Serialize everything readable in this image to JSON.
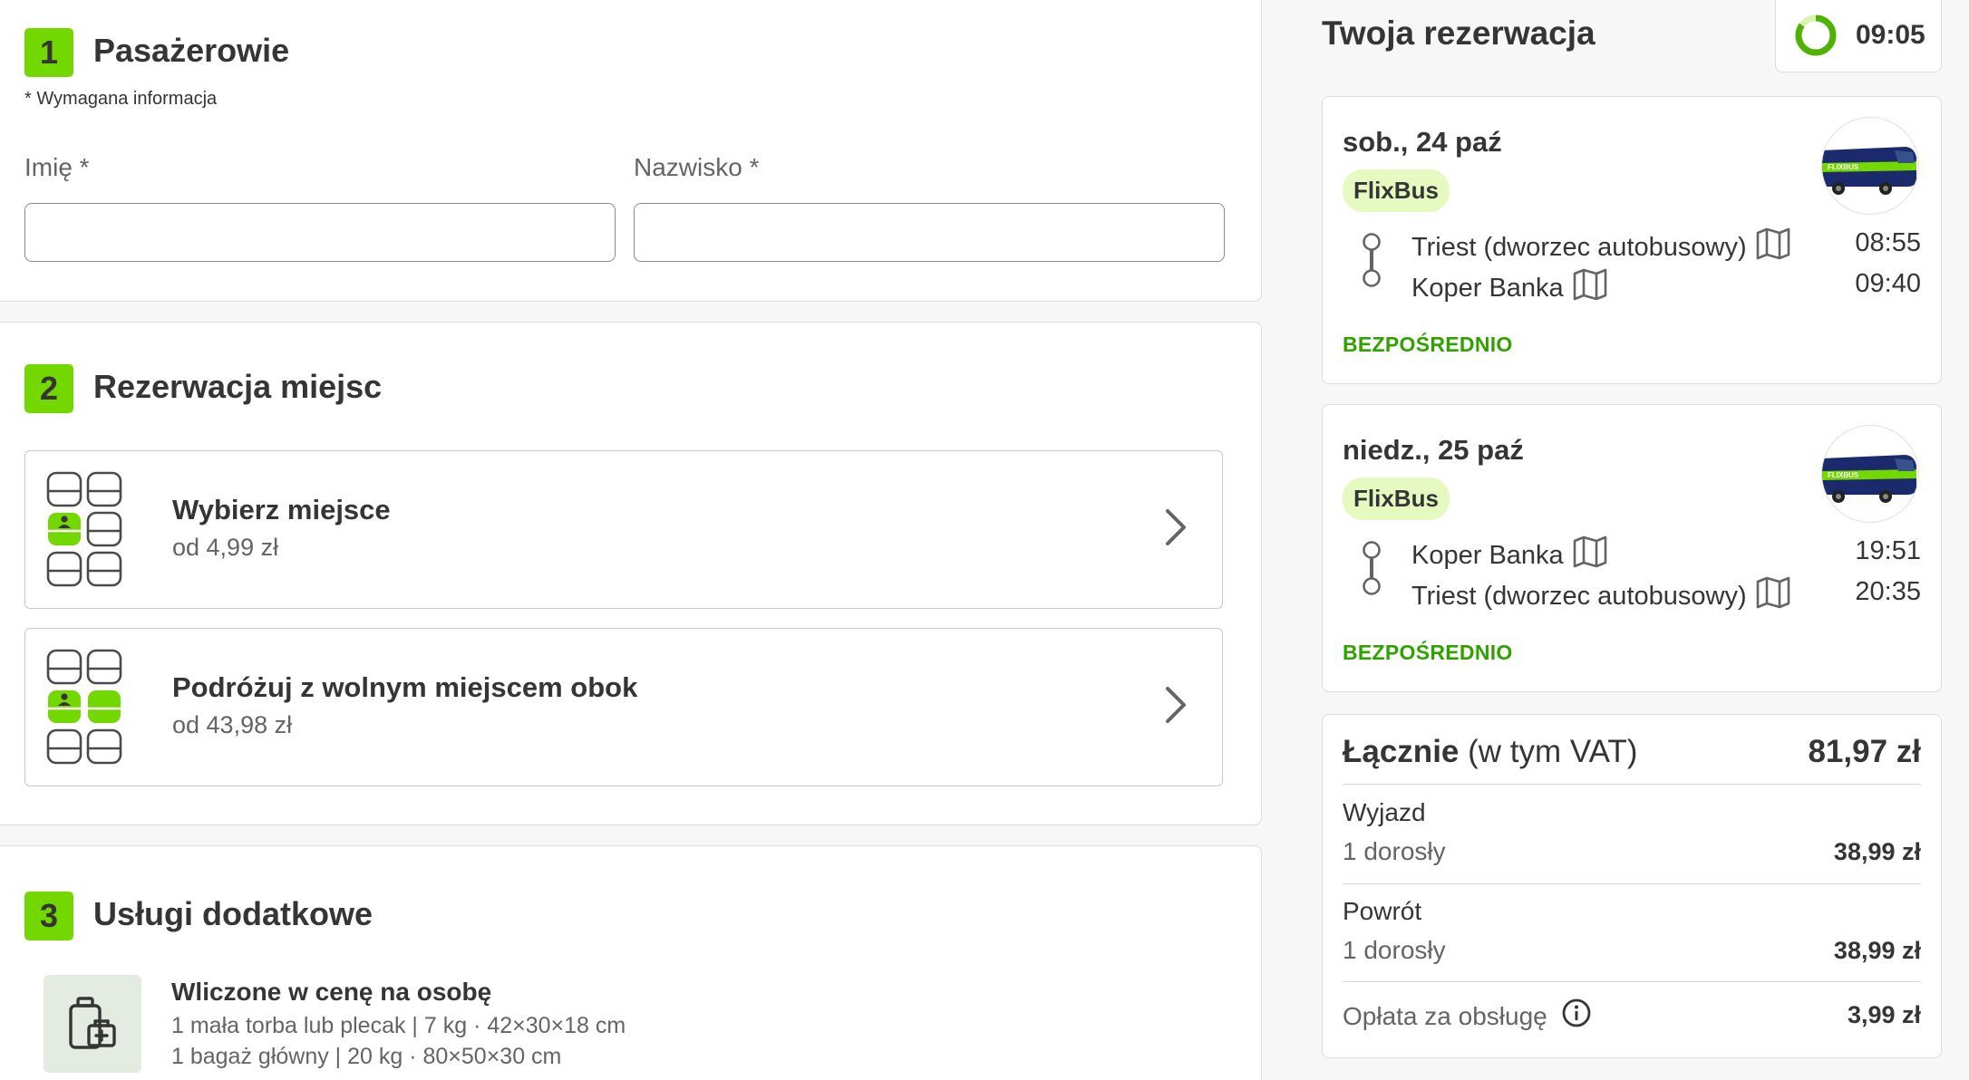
{
  "passengers": {
    "step": "1",
    "title": "Pasażerowie",
    "required_note": "* Wymagana informacja",
    "first_name_label": "Imię *",
    "first_name_value": "",
    "last_name_label": "Nazwisko *",
    "last_name_value": ""
  },
  "seats": {
    "step": "2",
    "title": "Rezerwacja miejsc",
    "options": [
      {
        "title": "Wybierz miejsce",
        "price": "od 4,99 zł"
      },
      {
        "title": "Podróżuj z wolnym miejscem obok",
        "price": "od 43,98 zł"
      }
    ]
  },
  "extras": {
    "step": "3",
    "title": "Usługi dodatkowe",
    "included_title": "Wliczone w cenę na osobę",
    "included_items": [
      "1 mała torba lub plecak | 7 kg · 42×30×18 cm",
      "1 bagaż główny | 20 kg · 80×50×30 cm"
    ]
  },
  "sidebar": {
    "title": "Twoja rezerwacja",
    "timer": "09:05",
    "timer_progress": 0.85,
    "trips": [
      {
        "date": "sob., 24 paź",
        "operator": "FlixBus",
        "bus_logo_text": "FLIXBUS",
        "stops": [
          {
            "name": "Triest (dworzec autobusowy)",
            "time": "08:55"
          },
          {
            "name": "Koper Banka",
            "time": "09:40"
          }
        ],
        "type": "BEZPOŚREDNIO"
      },
      {
        "date": "niedz., 25 paź",
        "operator": "FlixBus",
        "bus_logo_text": "FLIXBUS",
        "stops": [
          {
            "name": "Koper Banka",
            "time": "19:51"
          },
          {
            "name": "Triest (dworzec autobusowy)",
            "time": "20:35"
          }
        ],
        "type": "BEZPOŚREDNIO"
      }
    ],
    "total": {
      "label": "Łącznie",
      "vat_note": "(w tym VAT)",
      "amount": "81,97 zł",
      "rows": [
        {
          "label": "Wyjazd",
          "sub": "1 dorosły",
          "amount": "38,99 zł"
        },
        {
          "label": "Powrót",
          "sub": "1 dorosły",
          "amount": "38,99 zł"
        }
      ],
      "fee_label": "Opłata za obsługę",
      "fee_amount": "3,99 zł"
    }
  },
  "colors": {
    "accent": "#73d700",
    "accent_text": "#31a100",
    "tag_bg": "#e5f9c0",
    "text": "#353535",
    "muted": "#646464"
  },
  "icons": [
    "map-icon",
    "chevron-right-icon",
    "seat-icon",
    "person-icon",
    "luggage-icon",
    "info-icon",
    "timer-ring-icon",
    "bus-icon"
  ]
}
